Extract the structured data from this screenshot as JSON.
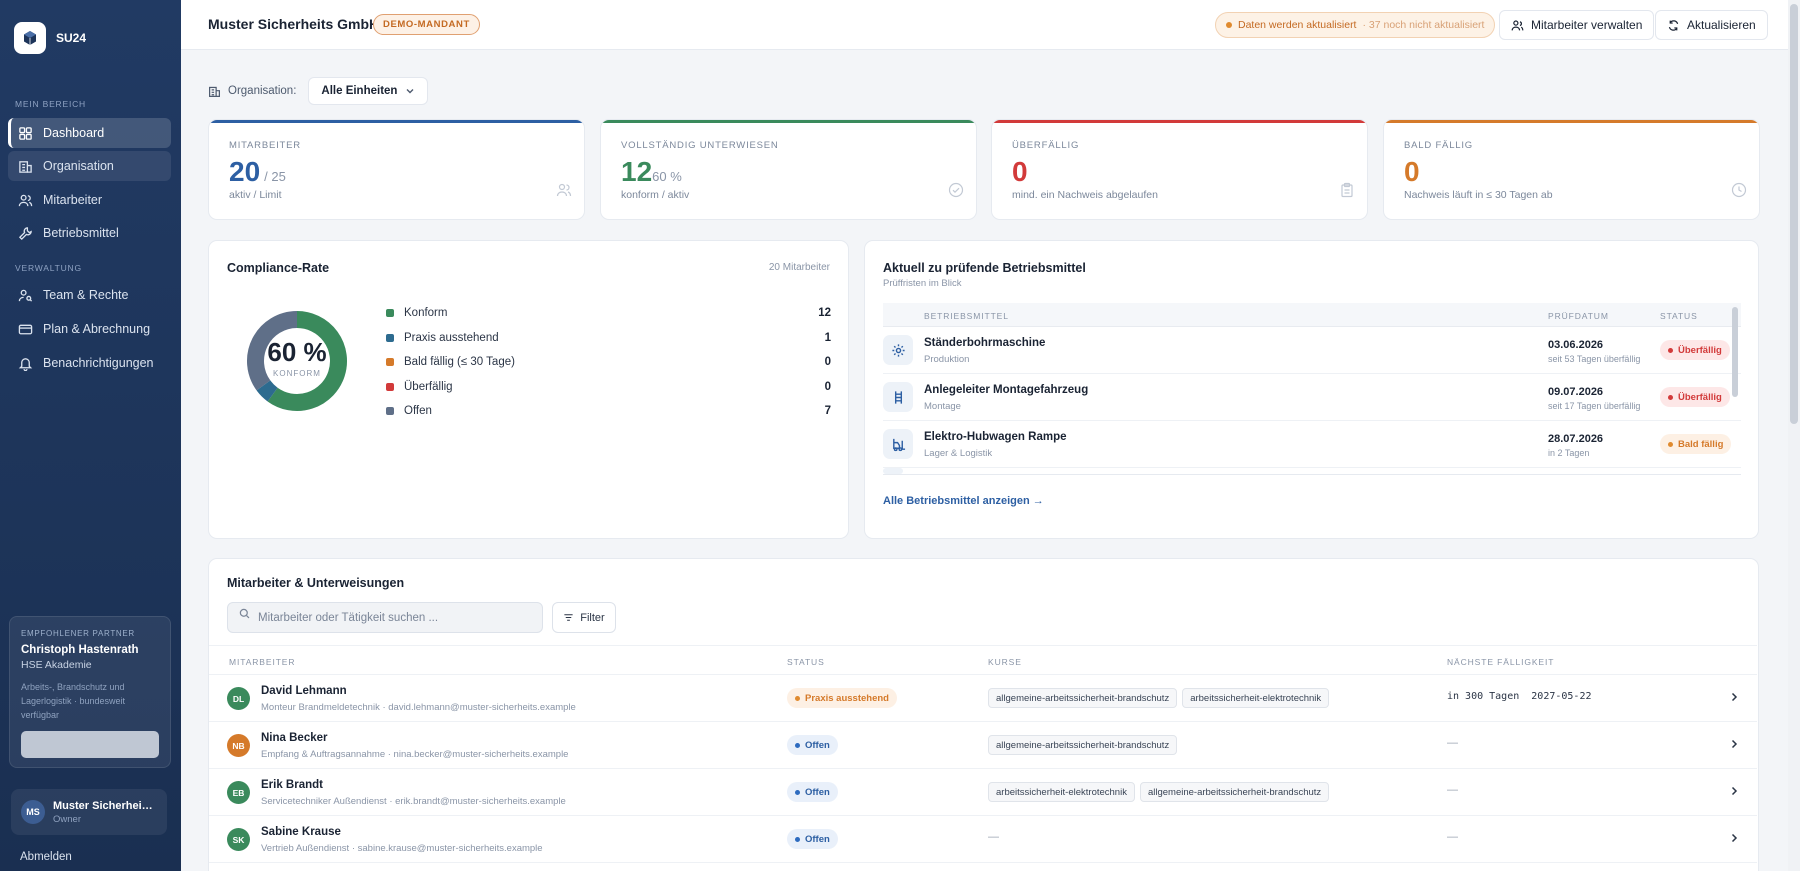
{
  "sidebar": {
    "brand": "SU24",
    "section_main": "MEIN BEREICH",
    "section_admin": "VERWALTUNG",
    "items": [
      {
        "label": "Dashboard",
        "icon": "dashboard-icon",
        "active": true
      },
      {
        "label": "Organisation",
        "icon": "building-icon"
      },
      {
        "label": "Mitarbeiter",
        "icon": "users-icon"
      },
      {
        "label": "Betriebsmittel",
        "icon": "wrench-icon"
      },
      {
        "label": "Team & Rechte",
        "icon": "user-key-icon"
      },
      {
        "label": "Plan & Abrechnung",
        "icon": "credit-card-icon"
      },
      {
        "label": "Benachrichtigungen",
        "icon": "bell-icon"
      }
    ],
    "partner": {
      "label": "EMPFOHLENER PARTNER",
      "name": "Christoph Hastenrath",
      "org": "HSE Akademie",
      "description": "Arbeits-, Brandschutz und Lagerlogistik · bundesweit verfügbar"
    },
    "user": {
      "initials": "MS",
      "name": "Muster Sicherheits GmbH",
      "role": "Owner"
    },
    "logout": "Abmelden"
  },
  "header": {
    "company": "Muster Sicherheits GmbH",
    "badge": "DEMO-MANDANT",
    "update_status": "Daten werden aktualisiert",
    "update_sub": "· 37 noch nicht aktualisiert",
    "manage_button": "Mitarbeiter verwalten",
    "refresh_button": "Aktualisieren"
  },
  "org_filter": {
    "label": "Organisation:",
    "value": "Alle Einheiten"
  },
  "kpis": [
    {
      "label": "MITARBEITER",
      "value": "20",
      "suffix": "/ 25",
      "sub": "aktiv / Limit",
      "color": "#2d5fa3",
      "icon": "users-icon"
    },
    {
      "label": "VOLLSTÄNDIG UNTERWIESEN",
      "value": "12",
      "suffix": "60 %",
      "sub": "konform / aktiv",
      "color": "#3a8a5c",
      "icon": "check-circle-icon"
    },
    {
      "label": "ÜBERFÄLLIG",
      "value": "0",
      "suffix": "",
      "sub": "mind. ein Nachweis abgelaufen",
      "color": "#d23a3a",
      "icon": "clipboard-icon"
    },
    {
      "label": "BALD FÄLLIG",
      "value": "0",
      "suffix": "",
      "sub": "Nachweis läuft in ≤ 30 Tagen ab",
      "color": "#d57a2a",
      "icon": "clock-icon"
    }
  ],
  "compliance": {
    "title": "Compliance-Rate",
    "meta": "20 Mitarbeiter",
    "percent_label": "60 %",
    "center_sub": "KONFORM"
  },
  "chart_data": {
    "type": "pie",
    "title": "Compliance-Rate",
    "categories": [
      "Konform",
      "Praxis ausstehend",
      "Bald fällig (≤ 30 Tage)",
      "Überfällig",
      "Offen"
    ],
    "values": [
      12,
      1,
      0,
      0,
      7
    ],
    "colors": [
      "#3a8a5c",
      "#2d6b8f",
      "#d57a2a",
      "#d23a3a",
      "#5f6f88"
    ]
  },
  "equipment": {
    "title": "Aktuell zu prüfende Betriebsmittel",
    "subtitle": "Prüffristen im Blick",
    "columns": [
      "BETRIEBSMITTEL",
      "PRÜFDATUM",
      "STATUS"
    ],
    "rows": [
      {
        "name": "Ständerbohrmaschine",
        "location": "Produktion",
        "date": "03.06.2026",
        "relative": "seit 53 Tagen überfällig",
        "status": "Überfällig",
        "tone": "red",
        "icon": "gear-icon"
      },
      {
        "name": "Anlegeleiter Montagefahrzeug",
        "location": "Montage",
        "date": "09.07.2026",
        "relative": "seit 17 Tagen überfällig",
        "status": "Überfällig",
        "tone": "red",
        "icon": "ladder-icon"
      },
      {
        "name": "Elektro-Hubwagen Rampe",
        "location": "Lager & Logistik",
        "date": "28.07.2026",
        "relative": "in 2 Tagen",
        "status": "Bald fällig",
        "tone": "orange",
        "icon": "forklift-icon"
      }
    ],
    "link": "Alle Betriebsmittel anzeigen →"
  },
  "employees": {
    "title": "Mitarbeiter & Unterweisungen",
    "search_placeholder": "Mitarbeiter oder Tätigkeit suchen ...",
    "filter_label": "Filter",
    "columns": [
      "MITARBEITER",
      "STATUS",
      "KURSE",
      "NÄCHSTE FÄLLIGKEIT"
    ],
    "rows": [
      {
        "initials": "DL",
        "color": "#3a8a5c",
        "name": "David Lehmann",
        "sub": "Monteur Brandmeldetechnik · david.lehmann@muster-sicherheits.example",
        "status": "Praxis ausstehend",
        "tone": "orange",
        "courses": [
          "allgemeine-arbeitssicherheit-brandschutz",
          "arbeitssicherheit-elektrotechnik"
        ],
        "due": "in 300 Tagen  2027-05-22"
      },
      {
        "initials": "NB",
        "color": "#d57a2a",
        "name": "Nina Becker",
        "sub": "Empfang & Auftragsannahme · nina.becker@muster-sicherheits.example",
        "status": "Offen",
        "tone": "blue",
        "courses": [
          "allgemeine-arbeitssicherheit-brandschutz"
        ],
        "due": "—"
      },
      {
        "initials": "EB",
        "color": "#3a8a5c",
        "name": "Erik Brandt",
        "sub": "Servicetechniker Außendienst · erik.brandt@muster-sicherheits.example",
        "status": "Offen",
        "tone": "blue",
        "courses": [
          "arbeitssicherheit-elektrotechnik",
          "allgemeine-arbeitssicherheit-brandschutz"
        ],
        "due": "—"
      },
      {
        "initials": "SK",
        "color": "#3a8a5c",
        "name": "Sabine Krause",
        "sub": "Vertrieb Außendienst · sabine.krause@muster-sicherheits.example",
        "status": "Offen",
        "tone": "blue",
        "courses": [],
        "courses_empty": "—",
        "due": "—"
      }
    ]
  }
}
